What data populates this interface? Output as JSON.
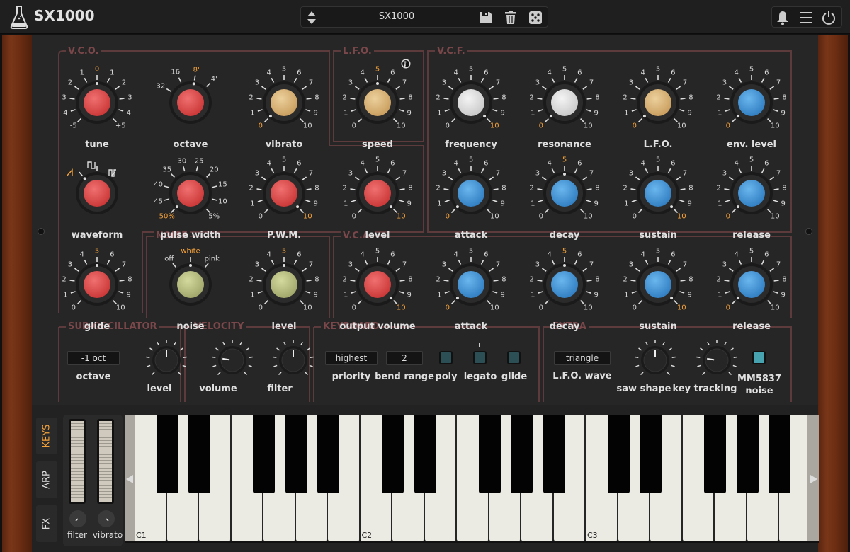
{
  "app": {
    "title": "SX1000"
  },
  "preset": {
    "name": "SX1000"
  },
  "icons": {
    "logo": "flask-icon",
    "prev_next": "up-down-arrows-icon",
    "save": "floppy-disk-icon",
    "delete": "trash-icon",
    "random": "dice-icon",
    "notifications": "bell-icon",
    "menu": "hamburger-menu-icon",
    "power": "power-icon",
    "tempo_sync": "note-icon"
  },
  "colors": {
    "accent": "#f5a23a",
    "section_border": "#5d3a3c",
    "knob_red": "#d94a4a",
    "knob_blue": "#3e8fd0",
    "knob_tan": "#d8b37c",
    "knob_white": "#e0e0e0",
    "knob_olive": "#b5bd7f",
    "switch_on": "#47a3b0"
  },
  "sections": {
    "vco": "V.C.O.",
    "lfo": "L.F.O.",
    "vcf": "V.C.F.",
    "noise": "NOISE",
    "vca": "V.C.A.",
    "sub": "SUB-OSCILLATOR",
    "velocity": "VELOCITY",
    "keyboard": "KEYBOARD",
    "extra": "EXTRA"
  },
  "knobs": [
    {
      "id": "vco-tune",
      "label": "tune",
      "color": "red",
      "scale": [
        "-5",
        "4",
        "3",
        "2",
        "1",
        "0",
        "1",
        "2",
        "3",
        "4",
        "+5"
      ],
      "value": "0"
    },
    {
      "id": "vco-octave",
      "label": "octave",
      "color": "red",
      "scale": [
        "32'",
        "16'",
        "8'",
        "4'"
      ],
      "value": "8'"
    },
    {
      "id": "vco-vibrato",
      "label": "vibrato",
      "color": "tan",
      "scale": [
        "0",
        "1",
        "2",
        "3",
        "4",
        "5",
        "6",
        "7",
        "8",
        "9",
        "10"
      ],
      "value": "0"
    },
    {
      "id": "lfo-speed",
      "label": "speed",
      "color": "tan",
      "scale": [
        "0",
        "1",
        "2",
        "3",
        "4",
        "5",
        "6",
        "7",
        "8",
        "9",
        "10"
      ],
      "value": "5"
    },
    {
      "id": "vcf-frequency",
      "label": "frequency",
      "color": "white",
      "scale": [
        "0",
        "1",
        "2",
        "3",
        "4",
        "5",
        "6",
        "7",
        "8",
        "9",
        "10"
      ],
      "value": "10"
    },
    {
      "id": "vcf-resonance",
      "label": "resonance",
      "color": "white",
      "scale": [
        "0",
        "1",
        "2",
        "3",
        "4",
        "5",
        "6",
        "7",
        "8",
        "9",
        "10"
      ],
      "value": "0"
    },
    {
      "id": "vcf-lfo",
      "label": "L.F.O.",
      "color": "tan",
      "scale": [
        "0",
        "1",
        "2",
        "3",
        "4",
        "5",
        "6",
        "7",
        "8",
        "9",
        "10"
      ],
      "value": "0"
    },
    {
      "id": "vcf-env-level",
      "label": "env. level",
      "color": "blue",
      "scale": [
        "0",
        "1",
        "2",
        "3",
        "4",
        "5",
        "6",
        "7",
        "8",
        "9",
        "10"
      ],
      "value": "0"
    },
    {
      "id": "vco-waveform",
      "label": "waveform",
      "color": "red",
      "scale": [
        "saw",
        "square",
        "pulse"
      ],
      "value": "saw"
    },
    {
      "id": "vco-pulse-width",
      "label": "pulse width",
      "color": "red",
      "scale": [
        "50%",
        "45",
        "40",
        "35",
        "30",
        "25",
        "20",
        "15",
        "10",
        "5%"
      ],
      "value": "50%"
    },
    {
      "id": "vco-pwm",
      "label": "P.W.M.",
      "color": "red",
      "scale": [
        "0",
        "1",
        "2",
        "3",
        "4",
        "5",
        "6",
        "7",
        "8",
        "9",
        "10"
      ],
      "value": "10"
    },
    {
      "id": "vco-level",
      "label": "level",
      "color": "red",
      "scale": [
        "0",
        "1",
        "2",
        "3",
        "4",
        "5",
        "6",
        "7",
        "8",
        "9",
        "10"
      ],
      "value": "10"
    },
    {
      "id": "vcf-attack",
      "label": "attack",
      "color": "blue",
      "scale": [
        "0",
        "1",
        "2",
        "3",
        "4",
        "5",
        "6",
        "7",
        "8",
        "9",
        "10"
      ],
      "value": "0"
    },
    {
      "id": "vcf-decay",
      "label": "decay",
      "color": "blue",
      "scale": [
        "0",
        "1",
        "2",
        "3",
        "4",
        "5",
        "6",
        "7",
        "8",
        "9",
        "10"
      ],
      "value": "5"
    },
    {
      "id": "vcf-sustain",
      "label": "sustain",
      "color": "blue",
      "scale": [
        "0",
        "1",
        "2",
        "3",
        "4",
        "5",
        "6",
        "7",
        "8",
        "9",
        "10"
      ],
      "value": "10"
    },
    {
      "id": "vcf-release",
      "label": "release",
      "color": "blue",
      "scale": [
        "0",
        "1",
        "2",
        "3",
        "4",
        "5",
        "6",
        "7",
        "8",
        "9",
        "10"
      ],
      "value": "0"
    },
    {
      "id": "vco-glide",
      "label": "glide",
      "color": "red",
      "scale": [
        "0",
        "1",
        "2",
        "3",
        "4",
        "5",
        "6",
        "7",
        "8",
        "9",
        "10"
      ],
      "value": "5"
    },
    {
      "id": "noise-type",
      "label": "noise",
      "color": "olive",
      "scale": [
        "off",
        "white",
        "pink"
      ],
      "value": "white"
    },
    {
      "id": "noise-level",
      "label": "level",
      "color": "olive",
      "scale": [
        "0",
        "1",
        "2",
        "3",
        "4",
        "5",
        "6",
        "7",
        "8",
        "9",
        "10"
      ],
      "value": "5"
    },
    {
      "id": "vca-output-volume",
      "label": "output volume",
      "color": "red",
      "scale": [
        "0",
        "1",
        "2",
        "3",
        "4",
        "5",
        "6",
        "7",
        "8",
        "9",
        "10"
      ],
      "value": "10"
    },
    {
      "id": "vca-attack",
      "label": "attack",
      "color": "blue",
      "scale": [
        "0",
        "1",
        "2",
        "3",
        "4",
        "5",
        "6",
        "7",
        "8",
        "9",
        "10"
      ],
      "value": "0"
    },
    {
      "id": "vca-decay",
      "label": "decay",
      "color": "blue",
      "scale": [
        "0",
        "1",
        "2",
        "3",
        "4",
        "5",
        "6",
        "7",
        "8",
        "9",
        "10"
      ],
      "value": "5"
    },
    {
      "id": "vca-sustain",
      "label": "sustain",
      "color": "blue",
      "scale": [
        "0",
        "1",
        "2",
        "3",
        "4",
        "5",
        "6",
        "7",
        "8",
        "9",
        "10"
      ],
      "value": "10"
    },
    {
      "id": "vca-release",
      "label": "release",
      "color": "blue",
      "scale": [
        "0",
        "1",
        "2",
        "3",
        "4",
        "5",
        "6",
        "7",
        "8",
        "9",
        "10"
      ],
      "value": "0"
    }
  ],
  "small_knobs": [
    {
      "id": "sub-level",
      "label": "level",
      "value": 0.5
    },
    {
      "id": "velocity-volume",
      "label": "volume",
      "value": 0.2
    },
    {
      "id": "velocity-filter",
      "label": "filter",
      "value": 0.5
    },
    {
      "id": "extra-saw-shape",
      "label": "saw shape",
      "value": 0.5
    },
    {
      "id": "extra-key-tracking",
      "label": "key tracking",
      "value": 0.2
    }
  ],
  "sub": {
    "octave_value": "-1 oct",
    "octave_label": "octave"
  },
  "keyboard": {
    "priority_value": "highest",
    "priority_label": "priority",
    "bend_value": "2",
    "bend_label": "bend range",
    "poly_label": "poly",
    "legato_label": "legato",
    "glide_label": "glide",
    "poly": false,
    "legato": false,
    "glide": false
  },
  "extra": {
    "lfo_wave_value": "triangle",
    "lfo_wave_label": "L.F.O. wave",
    "mm_label1": "MM5837",
    "mm_label2": "noise",
    "mm_on": true
  },
  "side_tabs": [
    {
      "label": "KEYS",
      "active": true
    },
    {
      "label": "ARP",
      "active": false
    },
    {
      "label": "FX",
      "active": false
    }
  ],
  "wheels": {
    "filter_label": "filter",
    "vibrato_label": "vibrato"
  },
  "piano": {
    "octave_labels": [
      "C1",
      "C2",
      "C3"
    ],
    "white_keys": 21
  }
}
